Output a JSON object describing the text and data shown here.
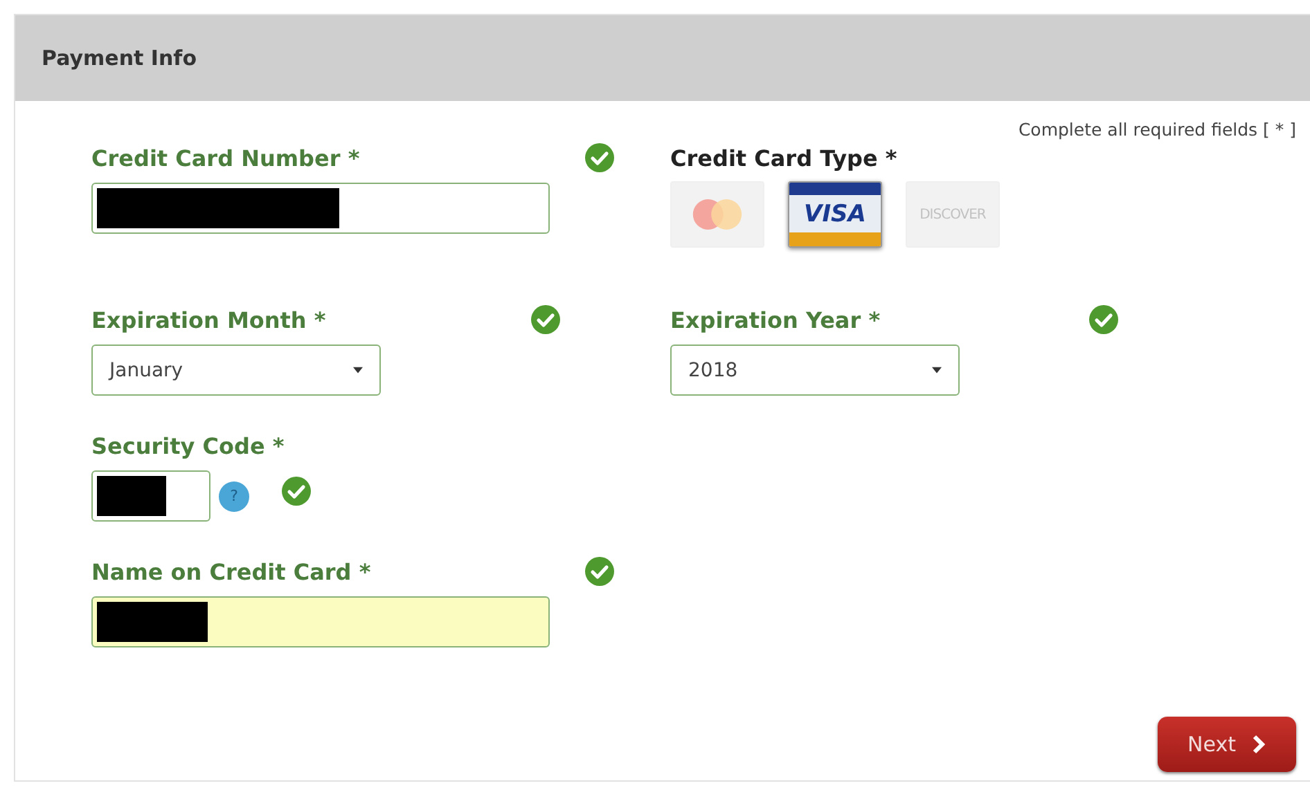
{
  "header": {
    "title": "Payment Info"
  },
  "required_note": "Complete all required fields [ * ]",
  "fields": [
    {
      "kind": "text",
      "label": "Credit Card Number *",
      "valid": true,
      "redacted": true,
      "highlighted": false
    },
    {
      "kind": "cards",
      "label": "Credit Card Type *",
      "cards": [
        {
          "kind": "mastercard",
          "selected": false
        },
        {
          "kind": "visa",
          "label": "VISA",
          "selected": true
        },
        {
          "kind": "discover",
          "label": "DISCOVER",
          "selected": false
        }
      ]
    },
    {
      "kind": "select",
      "label": "Expiration Month *",
      "valid": true,
      "value": "January"
    },
    {
      "kind": "select",
      "label": "Expiration Year *",
      "valid": true,
      "value": "2018"
    },
    {
      "kind": "code",
      "label": "Security Code *",
      "valid": true,
      "redacted": true,
      "help": "?"
    },
    {
      "kind": "text",
      "label": "Name on Credit Card *",
      "valid": true,
      "redacted": true,
      "highlighted": true
    }
  ],
  "next_button": {
    "label": "Next"
  }
}
